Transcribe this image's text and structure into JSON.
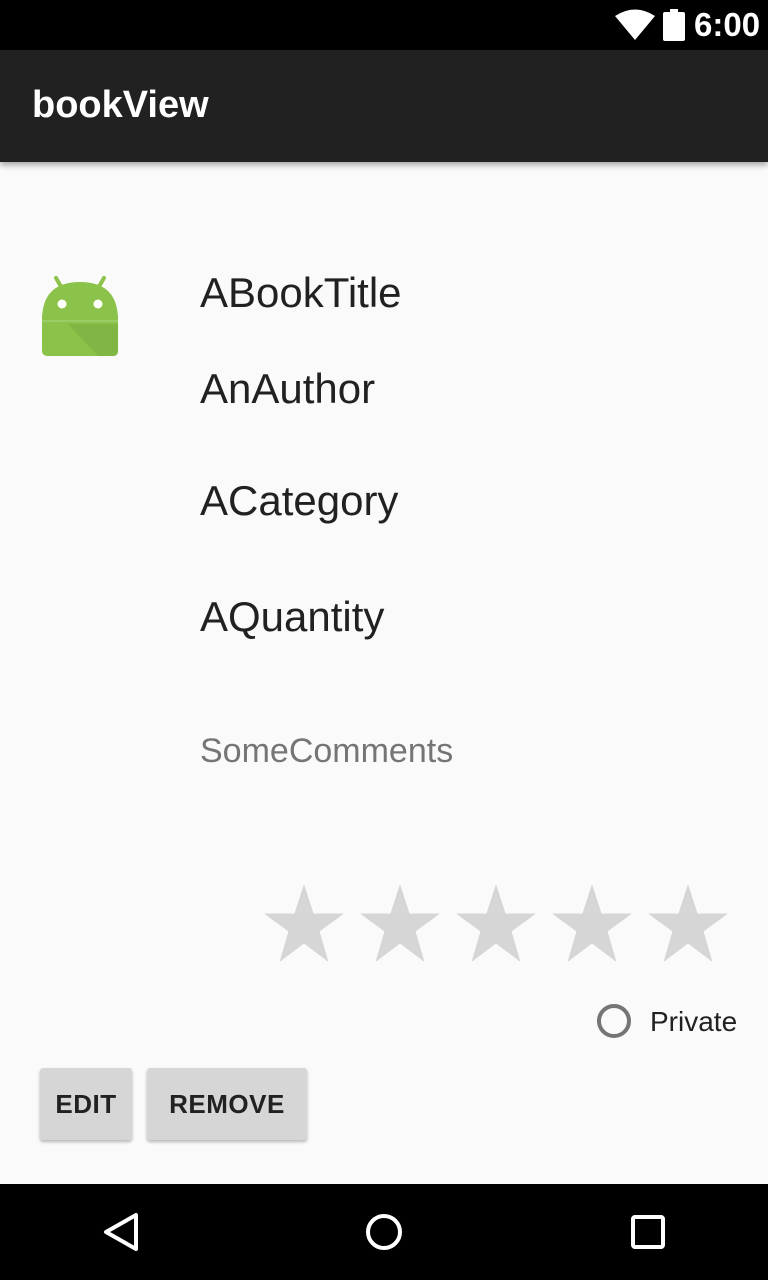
{
  "status_bar": {
    "time": "6:00",
    "icons": [
      "wifi-icon",
      "battery-icon"
    ]
  },
  "app_bar": {
    "title": "bookView"
  },
  "book": {
    "icon": "android-icon",
    "title": "ABookTitle",
    "author": "AnAuthor",
    "category": "ACategory",
    "quantity": "AQuantity",
    "comments": "SomeComments",
    "rating": 0,
    "rating_max": 5
  },
  "private_option": {
    "label": "Private",
    "checked": false
  },
  "actions": {
    "edit_label": "EDIT",
    "remove_label": "REMOVE"
  },
  "nav_bar": {
    "icons": [
      "back-icon",
      "home-icon",
      "recents-icon"
    ]
  },
  "colors": {
    "status_bar": "#000000",
    "app_bar": "#212121",
    "background": "#fafafa",
    "star_empty": "#d6d6d6",
    "button": "#d6d6d6",
    "android_green": "#8bc34a"
  }
}
